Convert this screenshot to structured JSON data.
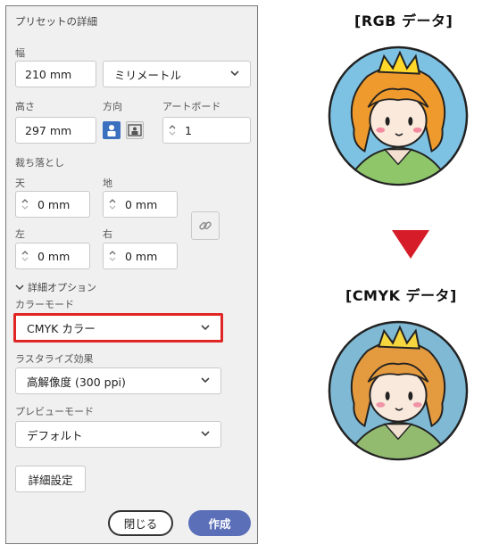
{
  "dialog": {
    "title": "プリセットの詳細",
    "width_label": "幅",
    "width_value": "210 mm",
    "unit_value": "ミリメートル",
    "height_label": "高さ",
    "height_value": "297 mm",
    "orientation_label": "方向",
    "artboard_label": "アートボード",
    "artboard_value": "1",
    "bleed_label": "裁ち落とし",
    "bleed_top_label": "天",
    "bleed_top_value": "0 mm",
    "bleed_bottom_label": "地",
    "bleed_bottom_value": "0 mm",
    "bleed_left_label": "左",
    "bleed_left_value": "0 mm",
    "bleed_right_label": "右",
    "bleed_right_value": "0 mm",
    "advanced_label": "詳細オプション",
    "color_mode_label": "カラーモード",
    "color_mode_value": "CMYK カラー",
    "raster_label": "ラスタライズ効果",
    "raster_value": "高解像度 (300 ppi)",
    "preview_label": "プレビューモード",
    "preview_value": "デフォルト",
    "more_settings_button": "詳細設定",
    "close_button": "閉じる",
    "create_button": "作成"
  },
  "comparison": {
    "rgb_heading": "[RGB データ]",
    "cmyk_heading": "[CMYK データ]"
  },
  "colors": {
    "highlight": "#e02525",
    "accent": "#5a6fb8",
    "arrow": "#d61c28",
    "rgb_background": "#7ec2e3",
    "cmyk_background": "#7fb9d4"
  }
}
